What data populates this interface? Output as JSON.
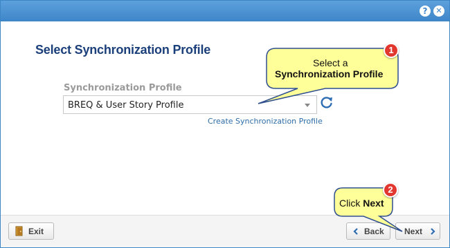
{
  "dialog": {
    "help_icon": "?",
    "close_icon": "✕",
    "heading": "Select Synchronization Profile"
  },
  "profile": {
    "label": "Synchronization Profile",
    "selected": "BREQ & User Story Profile",
    "create_link": "Create Synchronization Profile"
  },
  "footer": {
    "exit_label": "Exit",
    "back_label": "Back",
    "next_label": "Next"
  },
  "callouts": {
    "c1_line1": "Select a",
    "c1_line2": "Synchronization Profile",
    "c1_number": "1",
    "c2_prefix": "Click ",
    "c2_bold": "Next",
    "c2_number": "2"
  },
  "colors": {
    "titlebar": "#4a92d4",
    "heading": "#1b3f7a",
    "callout_fill": "#ffff99",
    "callout_border": "#2f4f8f",
    "badge": "#e2372f",
    "link": "#2e6da8"
  },
  "icons": [
    "help-icon",
    "close-icon",
    "refresh-icon",
    "exit-door-icon",
    "chevron-left-icon",
    "chevron-right-icon",
    "dropdown-arrow-icon"
  ]
}
